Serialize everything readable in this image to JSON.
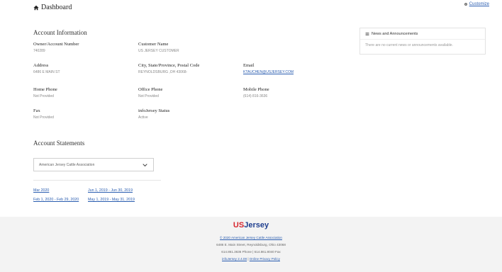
{
  "header": {
    "title": "Dashboard",
    "customize_label": "Customize"
  },
  "account": {
    "section_title": "Account Information",
    "owner_label": "Owner/Account Number",
    "owner_value": "740289",
    "customer_label": "Customer Name",
    "customer_value": "US JERSEY CUSTOMER",
    "address_label": "Address",
    "address_value": "6486 E MAIN ST",
    "city_label": "City, State/Province, Postal Code",
    "city_value": "REYNOLDSBURG ,OH 43068-",
    "email_label": "Email",
    "email_value": "KTAUCHEN@USJERSEY.COM",
    "home_phone_label": "Home Phone",
    "home_phone_value": "Not Provided",
    "office_phone_label": "Office Phone",
    "office_phone_value": "Not Provided",
    "mobile_phone_label": "Mobile Phone",
    "mobile_phone_value": "(614) 816-3636",
    "fax_label": "Fax",
    "fax_value": "Not Provided",
    "status_label": "infoJersey Status",
    "status_value": "Active"
  },
  "news": {
    "title": "News and Announcements",
    "body": "There are no current news or announcements available."
  },
  "statements": {
    "section_title": "Account Statements",
    "selected_org": "American Jersey Cattle Association",
    "links": [
      "Mar 2020",
      "Jun 1, 2019 - Jun 30, 2019",
      "Feb 1, 2020 - Feb 29, 2020",
      "May 1, 2019 - May 31, 2019"
    ]
  },
  "footer": {
    "brand_us": "US",
    "brand_jersey": "Jersey",
    "copyright": "© 2020 American Jersey Cattle Association",
    "address": "6486 E. Main Street, Reynoldsburg, Ohio 43068",
    "phones": "614.861.3636 Phone | 614.861.8040 Fax",
    "version": "infoJersey 2.4.08",
    "privacy": "Online Privacy Policy"
  },
  "colors": {
    "link": "#2a5db0",
    "brand_red": "#d7262e",
    "brand_blue": "#1f3f8f"
  }
}
